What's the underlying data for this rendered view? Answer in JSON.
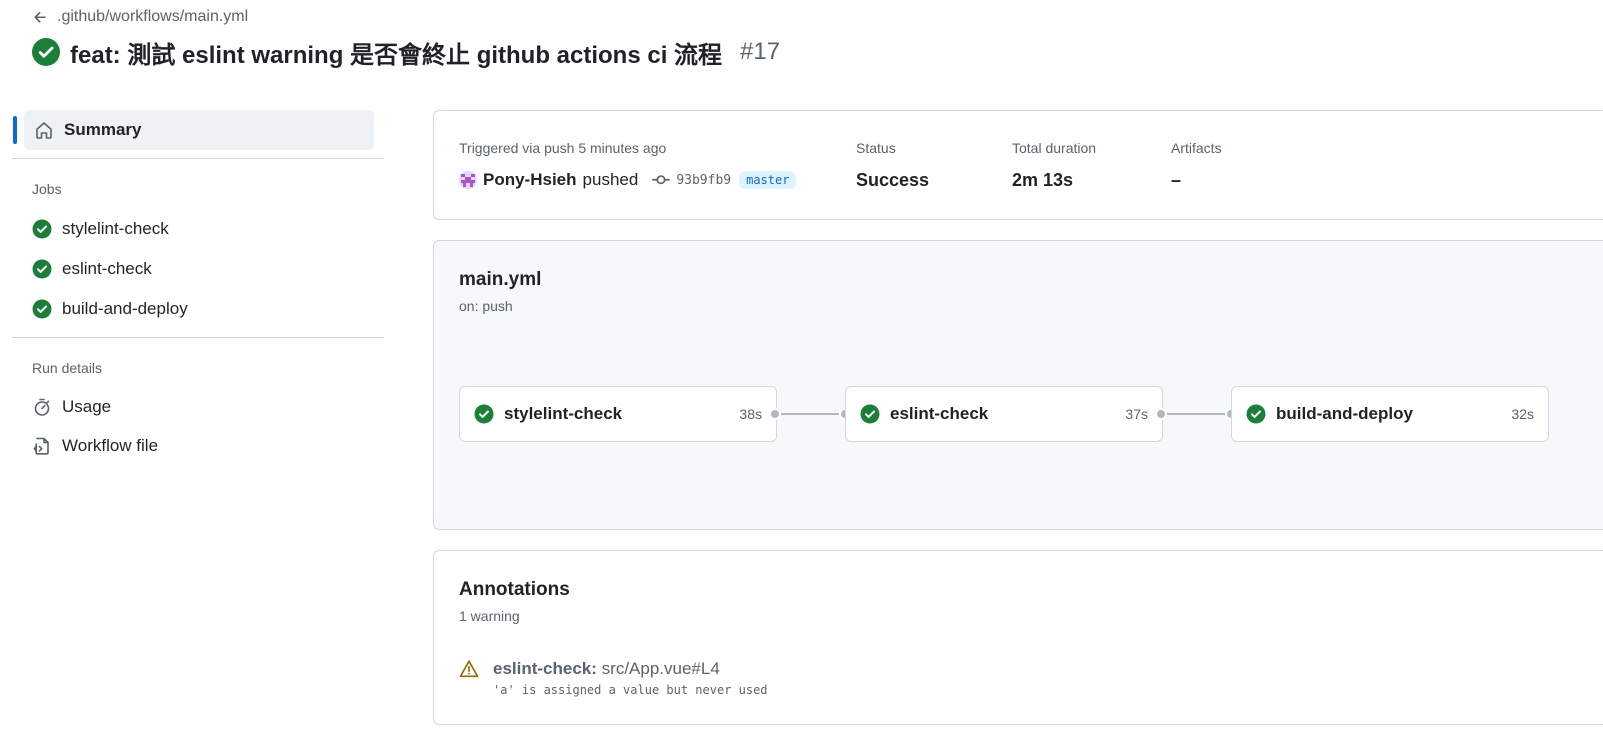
{
  "header": {
    "back_path": ".github/workflows/main.yml",
    "title": "feat: 測試 eslint warning 是否會終止 github actions ci 流程",
    "run_number": "#17"
  },
  "sidebar": {
    "summary_label": "Summary",
    "jobs_heading": "Jobs",
    "jobs": [
      {
        "label": "stylelint-check"
      },
      {
        "label": "eslint-check"
      },
      {
        "label": "build-and-deploy"
      }
    ],
    "run_details_heading": "Run details",
    "usage_label": "Usage",
    "workflow_file_label": "Workflow file"
  },
  "summary": {
    "trigger_label": "Triggered via push 5 minutes ago",
    "actor": "Pony-Hsieh",
    "verb": "pushed",
    "commit_sha": "93b9fb9",
    "branch": "master",
    "status_label": "Status",
    "status_value": "Success",
    "duration_label": "Total duration",
    "duration_value": "2m 13s",
    "artifacts_label": "Artifacts",
    "artifacts_value": "–"
  },
  "workflow": {
    "file": "main.yml",
    "trigger": "on: push",
    "jobs": [
      {
        "name": "stylelint-check",
        "duration": "38s"
      },
      {
        "name": "eslint-check",
        "duration": "37s"
      },
      {
        "name": "build-and-deploy",
        "duration": "32s"
      }
    ]
  },
  "annotations": {
    "title": "Annotations",
    "count": "1 warning",
    "items": [
      {
        "job": "eslint-check:",
        "location": "src/App.vue#L4",
        "message": "'a' is assigned a value but never used"
      }
    ]
  },
  "colors": {
    "success": "#1a7f37",
    "accent": "#0969da",
    "warning": "#9a6700",
    "muted": "#59636e",
    "border": "#d1d9e0"
  },
  "icons": {
    "back": "arrow-left-icon",
    "status": "check-circle-fill-icon",
    "summary": "home-icon",
    "usage": "stopwatch-icon",
    "workflow_file": "file-code-icon",
    "commit": "git-commit-icon",
    "warning": "alert-icon"
  }
}
